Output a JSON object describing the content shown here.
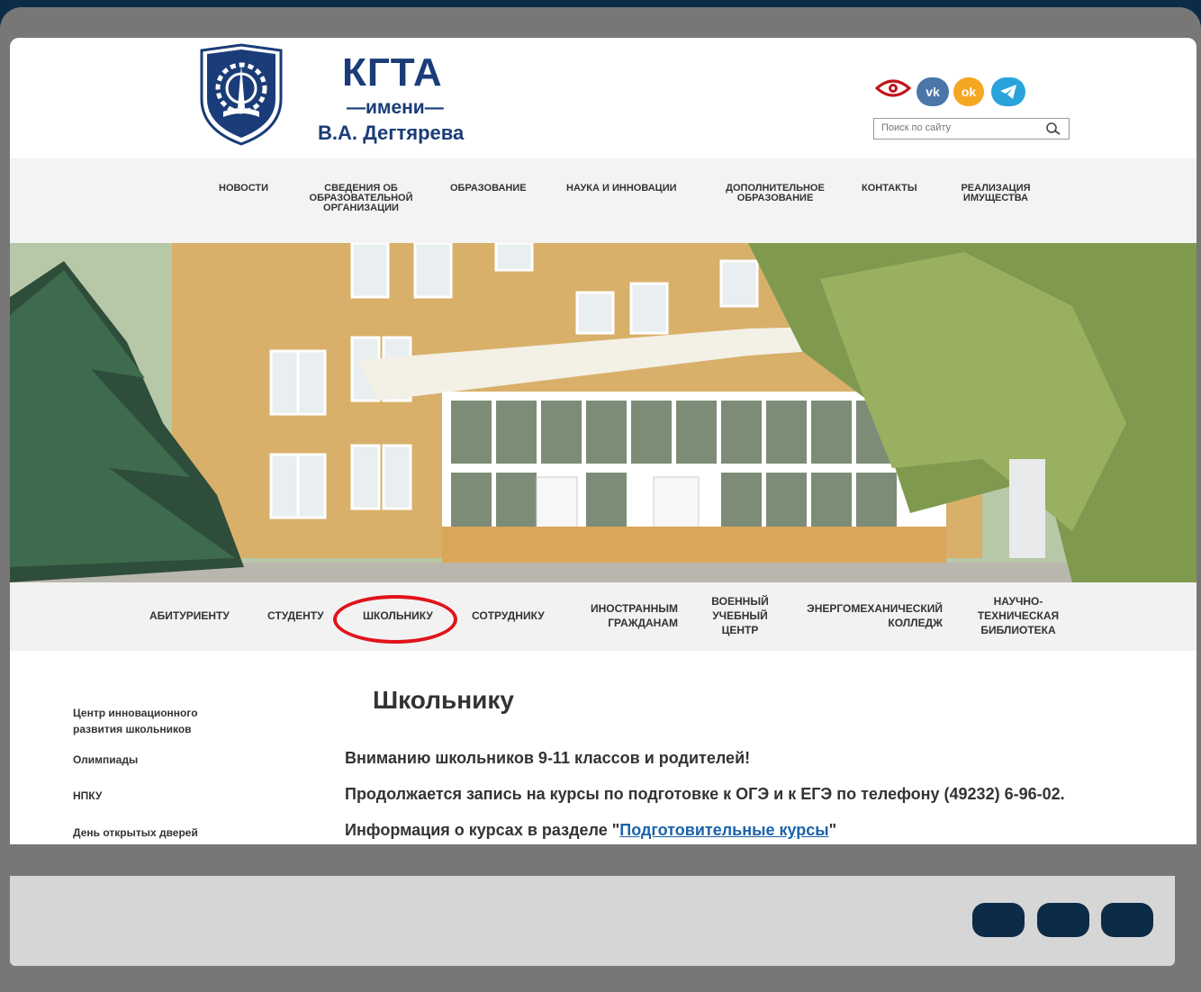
{
  "brand": {
    "title": "КГТА",
    "subtitle": "—имени—",
    "name": "В.А. Дегтярева"
  },
  "social": {
    "vk_label": "vk",
    "ok_label": "ok",
    "telegram_label": "tg"
  },
  "search": {
    "placeholder": "Поиск по сайту"
  },
  "topnav": {
    "news": "НОВОСТИ",
    "info": "СВЕДЕНИЯ ОБ ОБРАЗОВАТЕЛЬНОЙ ОРГАНИЗАЦИИ",
    "education": "ОБРАЗОВАНИЕ",
    "science": "НАУКА И ИННОВАЦИИ",
    "additional": "ДОПОЛНИТЕЛЬНОЕ ОБРАЗОВАНИЕ",
    "contacts": "КОНТАКТЫ",
    "property": "РЕАЛИЗАЦИЯ ИМУЩЕСТВА"
  },
  "secnav": {
    "applicant": "АБИТУРИЕНТУ",
    "student": "СТУДЕНТУ",
    "schoolchild": "ШКОЛЬНИКУ",
    "employee": "СОТРУДНИКУ",
    "foreign": "ИНОСТРАННЫМ ГРАЖДАНАМ",
    "military": "ВОЕННЫЙ УЧЕБНЫЙ ЦЕНТР",
    "college": "ЭНЕРГОМЕХАНИЧЕСКИЙ КОЛЛЕДЖ",
    "library": "НАУЧНО-ТЕХНИЧЕСКАЯ БИБЛИОТЕКА"
  },
  "sidebar": {
    "items": [
      "Центр инновационного развития школьников",
      "Олимпиады",
      "НПКУ",
      "День открытых дверей"
    ]
  },
  "main": {
    "title": "Школьнику",
    "line1": "Вниманию школьников 9-11 классов и родителей!",
    "line2": "Продолжается запись на курсы по подготовке к ОГЭ и к ЕГЭ по телефону (49232) 6-96-02.",
    "line3_prefix": "Информация о курсах в разделе \"",
    "line3_link": "Подготовительные курсы",
    "line3_suffix": "\""
  },
  "colors": {
    "brand": "#1a3c78",
    "frame": "#777777",
    "accent_ring": "#e0141a",
    "vk": "#4a76a8",
    "ok": "#f5a623",
    "telegram": "#2aa3dd"
  }
}
